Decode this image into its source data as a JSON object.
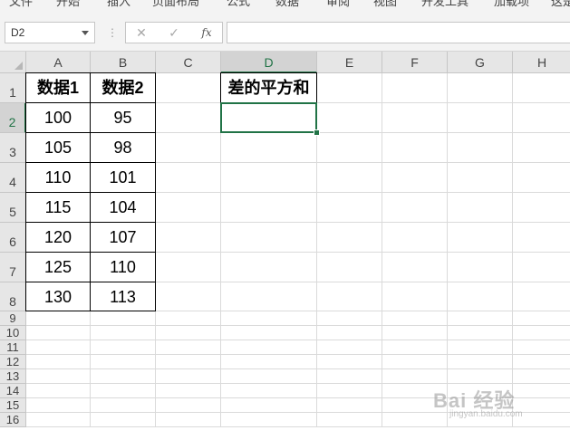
{
  "ribbon": {
    "tabs": [
      "文件",
      "开始",
      "插入",
      "页面布局",
      "公式",
      "数据",
      "审阅",
      "视图",
      "开发工具",
      "加载项",
      "这是"
    ]
  },
  "formula_bar": {
    "name_box": "D2",
    "cancel_icon": "✕",
    "enter_icon": "✓",
    "fx_label": "fx",
    "formula": ""
  },
  "columns": [
    "A",
    "B",
    "C",
    "D",
    "E",
    "F",
    "G",
    "H"
  ],
  "rows": [
    "1",
    "2",
    "3",
    "4",
    "5",
    "6",
    "7",
    "8",
    "9",
    "10",
    "11",
    "12",
    "13",
    "14",
    "15",
    "16"
  ],
  "cells": {
    "A1": "数据1",
    "B1": "数据2",
    "D1": "差的平方和",
    "A2": "100",
    "B2": "95",
    "A3": "105",
    "B3": "98",
    "A4": "110",
    "B4": "101",
    "A5": "115",
    "B5": "104",
    "A6": "120",
    "B6": "107",
    "A7": "125",
    "B7": "110",
    "A8": "130",
    "B8": "113"
  },
  "selected_cell": "D2",
  "watermark": {
    "text": "Bai 经验",
    "sub": "jingyan.baidu.com"
  },
  "colors": {
    "accent": "#217346",
    "header_bg": "#e6e6e6",
    "gridline": "#dadada"
  }
}
